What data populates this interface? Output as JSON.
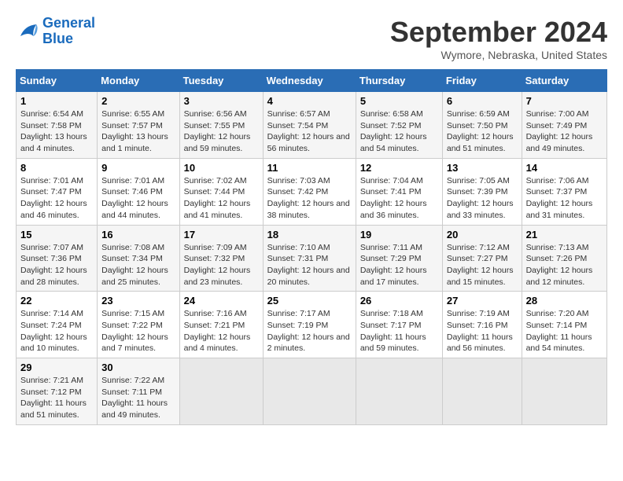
{
  "header": {
    "logo_line1": "General",
    "logo_line2": "Blue",
    "title": "September 2024",
    "location": "Wymore, Nebraska, United States"
  },
  "columns": [
    "Sunday",
    "Monday",
    "Tuesday",
    "Wednesday",
    "Thursday",
    "Friday",
    "Saturday"
  ],
  "weeks": [
    [
      {
        "day": "1",
        "sunrise": "Sunrise: 6:54 AM",
        "sunset": "Sunset: 7:58 PM",
        "daylight": "Daylight: 13 hours and 4 minutes."
      },
      {
        "day": "2",
        "sunrise": "Sunrise: 6:55 AM",
        "sunset": "Sunset: 7:57 PM",
        "daylight": "Daylight: 13 hours and 1 minute."
      },
      {
        "day": "3",
        "sunrise": "Sunrise: 6:56 AM",
        "sunset": "Sunset: 7:55 PM",
        "daylight": "Daylight: 12 hours and 59 minutes."
      },
      {
        "day": "4",
        "sunrise": "Sunrise: 6:57 AM",
        "sunset": "Sunset: 7:54 PM",
        "daylight": "Daylight: 12 hours and 56 minutes."
      },
      {
        "day": "5",
        "sunrise": "Sunrise: 6:58 AM",
        "sunset": "Sunset: 7:52 PM",
        "daylight": "Daylight: 12 hours and 54 minutes."
      },
      {
        "day": "6",
        "sunrise": "Sunrise: 6:59 AM",
        "sunset": "Sunset: 7:50 PM",
        "daylight": "Daylight: 12 hours and 51 minutes."
      },
      {
        "day": "7",
        "sunrise": "Sunrise: 7:00 AM",
        "sunset": "Sunset: 7:49 PM",
        "daylight": "Daylight: 12 hours and 49 minutes."
      }
    ],
    [
      {
        "day": "8",
        "sunrise": "Sunrise: 7:01 AM",
        "sunset": "Sunset: 7:47 PM",
        "daylight": "Daylight: 12 hours and 46 minutes."
      },
      {
        "day": "9",
        "sunrise": "Sunrise: 7:01 AM",
        "sunset": "Sunset: 7:46 PM",
        "daylight": "Daylight: 12 hours and 44 minutes."
      },
      {
        "day": "10",
        "sunrise": "Sunrise: 7:02 AM",
        "sunset": "Sunset: 7:44 PM",
        "daylight": "Daylight: 12 hours and 41 minutes."
      },
      {
        "day": "11",
        "sunrise": "Sunrise: 7:03 AM",
        "sunset": "Sunset: 7:42 PM",
        "daylight": "Daylight: 12 hours and 38 minutes."
      },
      {
        "day": "12",
        "sunrise": "Sunrise: 7:04 AM",
        "sunset": "Sunset: 7:41 PM",
        "daylight": "Daylight: 12 hours and 36 minutes."
      },
      {
        "day": "13",
        "sunrise": "Sunrise: 7:05 AM",
        "sunset": "Sunset: 7:39 PM",
        "daylight": "Daylight: 12 hours and 33 minutes."
      },
      {
        "day": "14",
        "sunrise": "Sunrise: 7:06 AM",
        "sunset": "Sunset: 7:37 PM",
        "daylight": "Daylight: 12 hours and 31 minutes."
      }
    ],
    [
      {
        "day": "15",
        "sunrise": "Sunrise: 7:07 AM",
        "sunset": "Sunset: 7:36 PM",
        "daylight": "Daylight: 12 hours and 28 minutes."
      },
      {
        "day": "16",
        "sunrise": "Sunrise: 7:08 AM",
        "sunset": "Sunset: 7:34 PM",
        "daylight": "Daylight: 12 hours and 25 minutes."
      },
      {
        "day": "17",
        "sunrise": "Sunrise: 7:09 AM",
        "sunset": "Sunset: 7:32 PM",
        "daylight": "Daylight: 12 hours and 23 minutes."
      },
      {
        "day": "18",
        "sunrise": "Sunrise: 7:10 AM",
        "sunset": "Sunset: 7:31 PM",
        "daylight": "Daylight: 12 hours and 20 minutes."
      },
      {
        "day": "19",
        "sunrise": "Sunrise: 7:11 AM",
        "sunset": "Sunset: 7:29 PM",
        "daylight": "Daylight: 12 hours and 17 minutes."
      },
      {
        "day": "20",
        "sunrise": "Sunrise: 7:12 AM",
        "sunset": "Sunset: 7:27 PM",
        "daylight": "Daylight: 12 hours and 15 minutes."
      },
      {
        "day": "21",
        "sunrise": "Sunrise: 7:13 AM",
        "sunset": "Sunset: 7:26 PM",
        "daylight": "Daylight: 12 hours and 12 minutes."
      }
    ],
    [
      {
        "day": "22",
        "sunrise": "Sunrise: 7:14 AM",
        "sunset": "Sunset: 7:24 PM",
        "daylight": "Daylight: 12 hours and 10 minutes."
      },
      {
        "day": "23",
        "sunrise": "Sunrise: 7:15 AM",
        "sunset": "Sunset: 7:22 PM",
        "daylight": "Daylight: 12 hours and 7 minutes."
      },
      {
        "day": "24",
        "sunrise": "Sunrise: 7:16 AM",
        "sunset": "Sunset: 7:21 PM",
        "daylight": "Daylight: 12 hours and 4 minutes."
      },
      {
        "day": "25",
        "sunrise": "Sunrise: 7:17 AM",
        "sunset": "Sunset: 7:19 PM",
        "daylight": "Daylight: 12 hours and 2 minutes."
      },
      {
        "day": "26",
        "sunrise": "Sunrise: 7:18 AM",
        "sunset": "Sunset: 7:17 PM",
        "daylight": "Daylight: 11 hours and 59 minutes."
      },
      {
        "day": "27",
        "sunrise": "Sunrise: 7:19 AM",
        "sunset": "Sunset: 7:16 PM",
        "daylight": "Daylight: 11 hours and 56 minutes."
      },
      {
        "day": "28",
        "sunrise": "Sunrise: 7:20 AM",
        "sunset": "Sunset: 7:14 PM",
        "daylight": "Daylight: 11 hours and 54 minutes."
      }
    ],
    [
      {
        "day": "29",
        "sunrise": "Sunrise: 7:21 AM",
        "sunset": "Sunset: 7:12 PM",
        "daylight": "Daylight: 11 hours and 51 minutes."
      },
      {
        "day": "30",
        "sunrise": "Sunrise: 7:22 AM",
        "sunset": "Sunset: 7:11 PM",
        "daylight": "Daylight: 11 hours and 49 minutes."
      },
      null,
      null,
      null,
      null,
      null
    ]
  ]
}
